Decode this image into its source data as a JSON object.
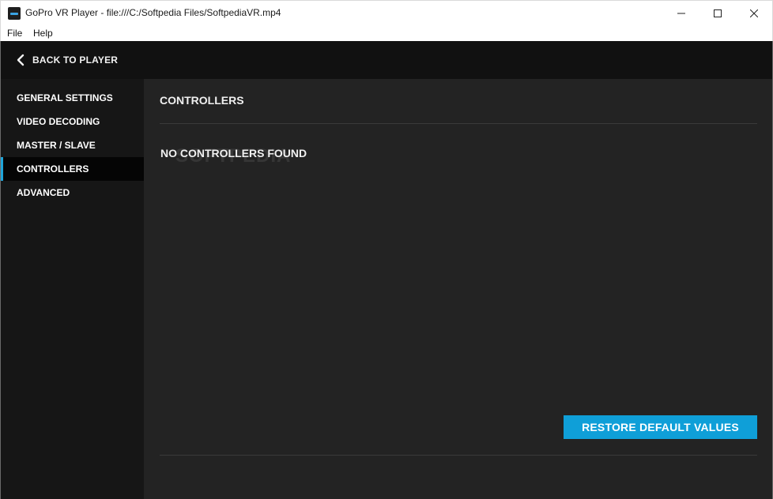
{
  "window": {
    "title": "GoPro VR Player - file:///C:/Softpedia Files/SoftpediaVR.mp4",
    "app_icon": "gopro-vr-player-icon",
    "controls": [
      "minimize-icon",
      "maximize-icon",
      "close-icon"
    ]
  },
  "menubar": {
    "items": [
      "File",
      "Help"
    ]
  },
  "topbar": {
    "back_label": "BACK TO PLAYER",
    "back_icon": "chevron-left-icon"
  },
  "sidebar": {
    "items": [
      {
        "label": "GENERAL SETTINGS",
        "active": false
      },
      {
        "label": "VIDEO DECODING",
        "active": false
      },
      {
        "label": "MASTER / SLAVE",
        "active": false
      },
      {
        "label": "CONTROLLERS",
        "active": true
      },
      {
        "label": "ADVANCED",
        "active": false
      }
    ]
  },
  "main": {
    "section_title": "CONTROLLERS",
    "empty_message": "NO CONTROLLERS FOUND",
    "watermark": "SOFTPEDIA",
    "restore_button": "RESTORE DEFAULT VALUES"
  },
  "colors": {
    "accent": "#1ea4d8",
    "button": "#0f9fd8",
    "background": "#232323",
    "sidebar": "#161616",
    "topbar": "#111111"
  }
}
